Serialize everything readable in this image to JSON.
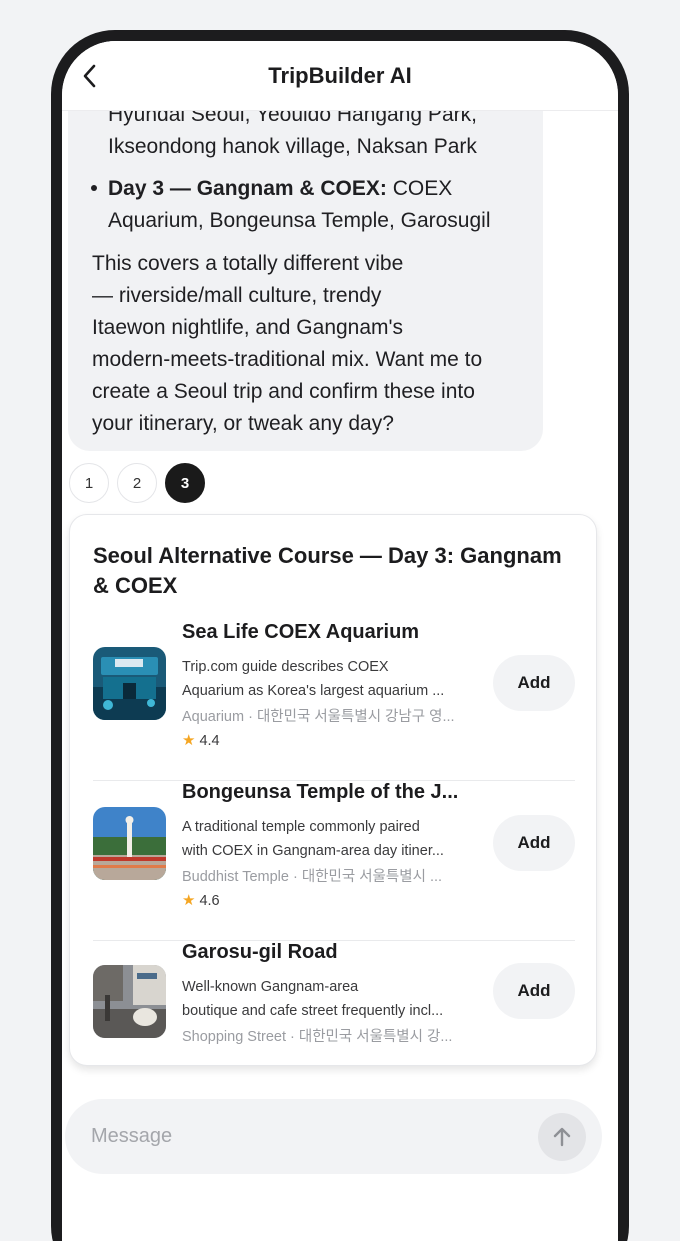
{
  "header": {
    "title": "TripBuilder AI"
  },
  "message": {
    "lines_top": [
      "Hyundai Seoul, Yeouido Hangang Park,",
      "Ikseondong hanok village, Naksan Park"
    ],
    "day3_bold": "Day 3 — Gangnam & COEX:",
    "day3_rest": "COEX",
    "day3_line2": "Aquarium, Bongeunsa Temple, Garosugil",
    "paragraph": [
      "This covers a totally different vibe",
      "— riverside/mall culture, trendy",
      "Itaewon nightlife, and Gangnam's",
      "modern-meets-traditional mix. Want me to",
      "create a Seoul trip and confirm these into",
      "your itinerary, or tweak any day?"
    ]
  },
  "pager": {
    "pages": [
      "1",
      "2",
      "3"
    ],
    "active": "3"
  },
  "card": {
    "title": "Seoul Alternative Course — Day 3: Gangnam & COEX",
    "add_label": "Add",
    "places": [
      {
        "name": "Sea Life COEX Aquarium",
        "desc_line1": "Trip.com guide describes COEX",
        "desc_line2": "Aquarium as Korea's largest aquarium ...",
        "meta": "Aquarium · 대한민국 서울특별시 강남구 영...",
        "rating": "4.4"
      },
      {
        "name": "Bongeunsa Temple of the J...",
        "desc_line1": "A traditional temple commonly paired",
        "desc_line2": "with COEX in Gangnam-area day itiner...",
        "meta": "Buddhist Temple · 대한민국 서울특별시 ...",
        "rating": "4.6"
      },
      {
        "name": "Garosu-gil Road",
        "desc_line1": "Well-known Gangnam-area",
        "desc_line2": "boutique and cafe street frequently incl...",
        "meta": "Shopping Street · 대한민국 서울특별시 강...",
        "rating": ""
      }
    ]
  },
  "composer": {
    "placeholder": "Message"
  },
  "colors": {
    "star": "#f5a623",
    "active_page": "#1a1a1a",
    "bubble": "#f1f2f4"
  },
  "icons": {
    "back": "chevron-left-icon",
    "send": "arrow-up-icon",
    "star": "star-icon"
  }
}
